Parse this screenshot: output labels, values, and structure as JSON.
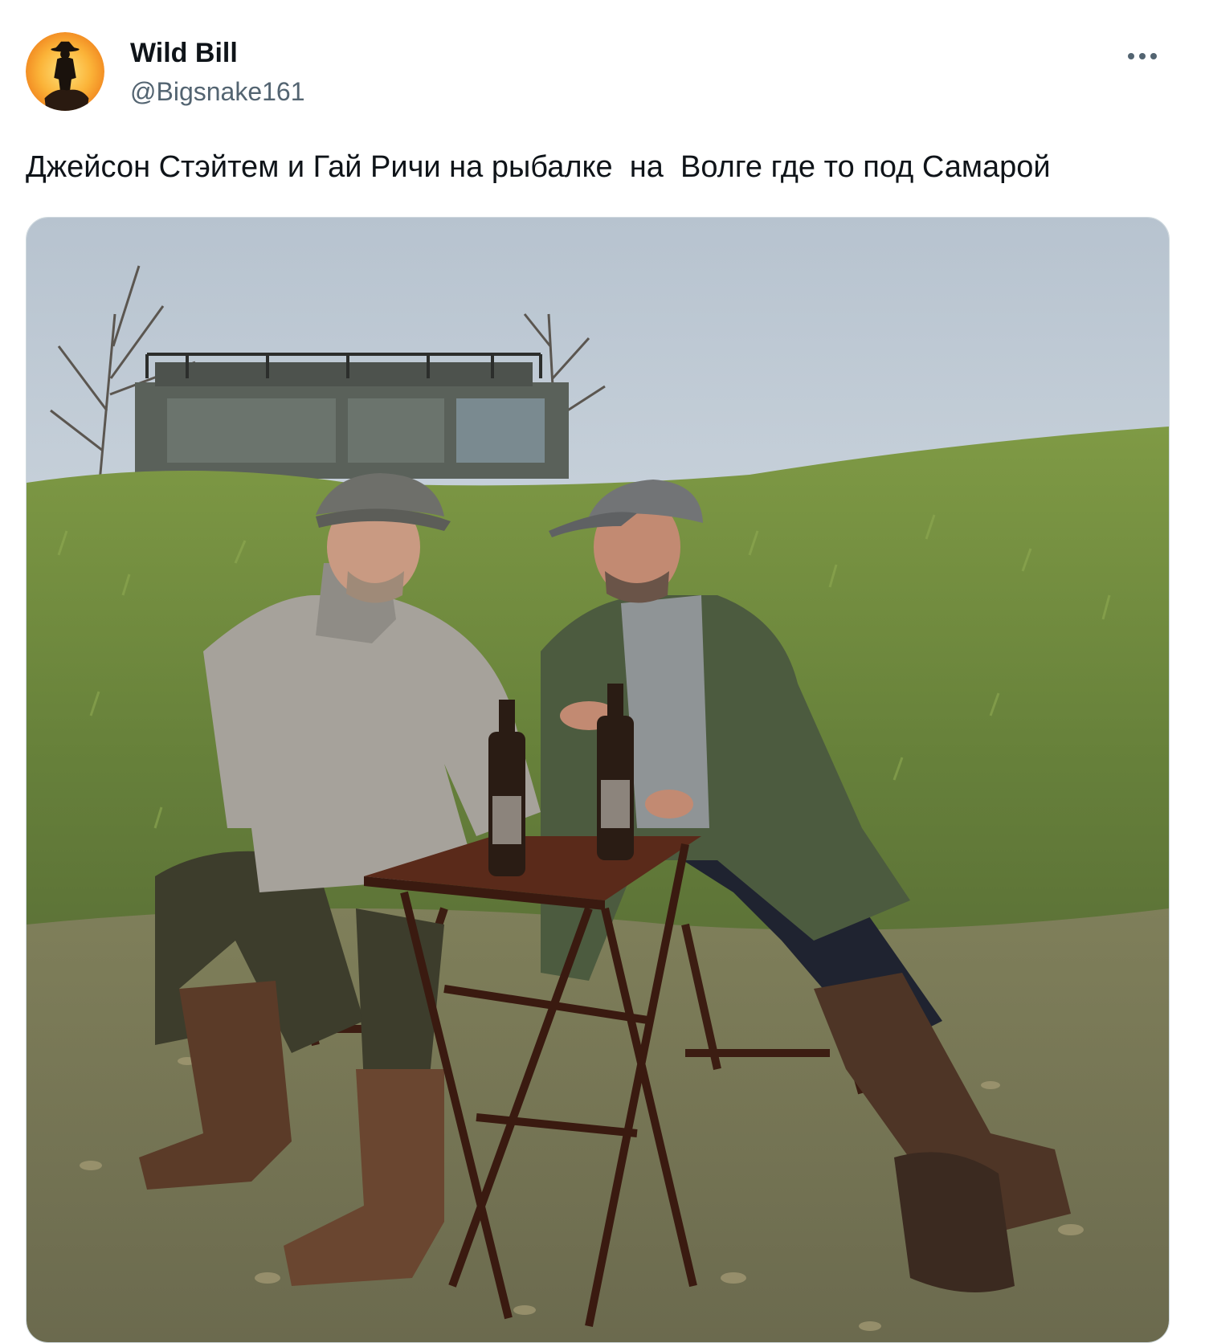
{
  "author": {
    "display_name": "Wild Bill",
    "handle": "@Bigsnake161",
    "avatar_icon": "cowboy-silhouette-sunset-icon"
  },
  "more_icon": "more-horizontal-icon",
  "tweet": {
    "text": "Джейсон Стэйтем и Гай Ричи на рыбалке  на  Волге где то под Самарой"
  },
  "colors": {
    "name": "#0f1419",
    "secondary": "#536471",
    "sky": "#c9d4de",
    "grass": "#6f8a3a",
    "ground": "#8a8a6a",
    "table": "#4a2216",
    "cap": "#6d6f70",
    "green_jacket": "#4b5a3e",
    "grey_jacket": "#a9a6a0",
    "boots": "#5a3a26"
  }
}
